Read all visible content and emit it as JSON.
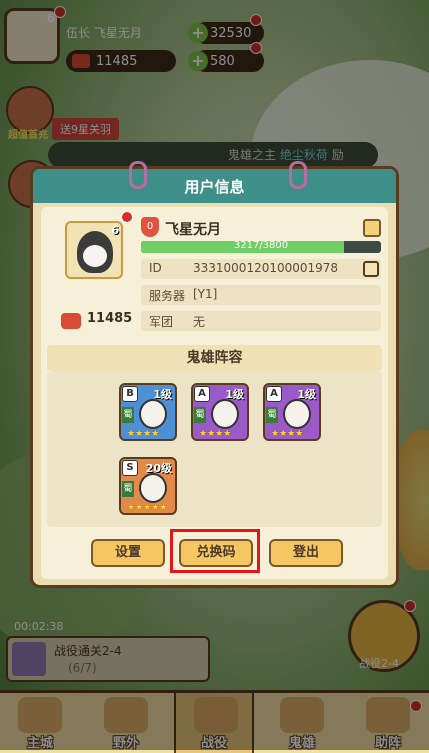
{
  "hud": {
    "player_name": "伍长 飞星无月",
    "avatar_level": "6",
    "power": "11485",
    "gold": "32530",
    "gems": "580"
  },
  "side": {
    "promo_label": "超值首充",
    "star_banner": "送9星关羽",
    "ticker": "鬼雄之主",
    "ticker_name": "绝尘秋荷",
    "ticker_suffix": "励",
    "timer": "00:02:38",
    "quest_title": "战役通关2-4",
    "quest_progress": "(6/7)",
    "battle_label": "战役2-4"
  },
  "panel": {
    "title": "用户信息",
    "player_name": "飞星无月",
    "avatar_level": "6",
    "rank_badge": "0",
    "exp_text": "3217/3800",
    "exp_fraction": 0.8466,
    "id_label": "ID",
    "id_value": "3331000120100001978",
    "server_label": "服务器",
    "server_value": "[Y1]",
    "legion_label": "军团",
    "legion_value": "无",
    "power": "11485",
    "lineup_title": "鬼雄阵容",
    "heroes": [
      {
        "grade": "B",
        "level": "1级",
        "faction": "蜀",
        "stars": "★★★★"
      },
      {
        "grade": "A",
        "level": "1级",
        "faction": "蜀",
        "stars": "★★★★"
      },
      {
        "grade": "A",
        "level": "1级",
        "faction": "蜀",
        "stars": "★★★★"
      },
      {
        "grade": "S",
        "level": "20级",
        "faction": "蜀",
        "stars": "★★★★★"
      }
    ],
    "buttons": {
      "settings": "设置",
      "redeem": "兑换码",
      "logout": "登出"
    }
  },
  "tabs": [
    "主城",
    "野外",
    "战役",
    "鬼雄",
    "助阵"
  ],
  "colors": {
    "header_teal": "#3e8e89",
    "panel_bg": "#e9ddb1",
    "button_gold": "#f4c764",
    "highlight_red": "#e3161a",
    "exp_green": "#6fcf66"
  }
}
